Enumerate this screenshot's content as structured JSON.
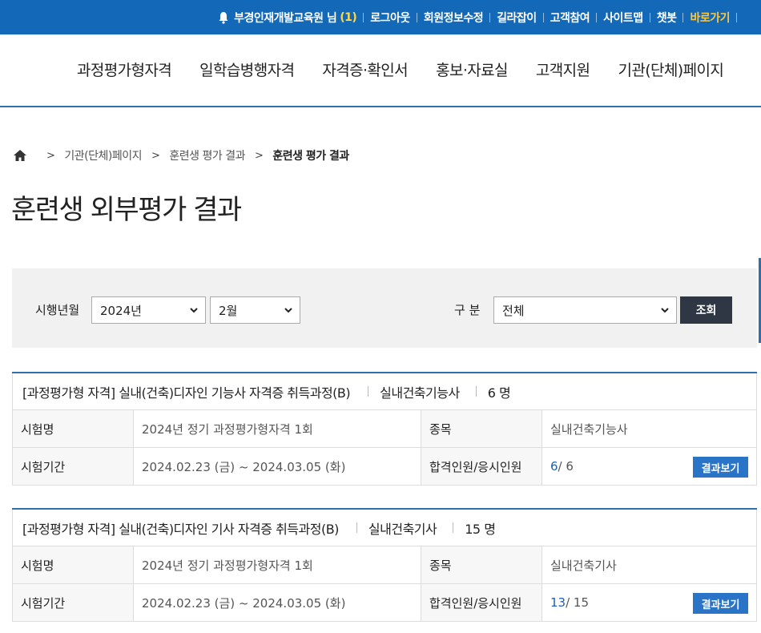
{
  "utility_bar": {
    "user": "부경인재개발교육원 님",
    "notice_count": "(1)",
    "links": [
      "로그아웃",
      "회원정보수정",
      "길라잡이",
      "고객참여",
      "사이트맵",
      "챗봇"
    ],
    "shortcut": "바로가기"
  },
  "nav": {
    "items": [
      "과정평가형자격",
      "일학습병행자격",
      "자격증·확인서",
      "홍보·자료실",
      "고객지원",
      "기관(단체)페이지"
    ]
  },
  "breadcrumb": {
    "items": [
      "기관(단체)페이지",
      "훈련생 평가 결과"
    ],
    "current": "훈련생 평가 결과"
  },
  "page_title": "훈련생 외부평가 결과",
  "search": {
    "date_label": "시행년월",
    "year": "2024년",
    "month": "2월",
    "category_label": "구 분",
    "category": "전체",
    "submit": "조회"
  },
  "results": [
    {
      "course": "[과정평가형 자격] 실내(건축)디자인 기능사 자격증 취득과정(B)",
      "item": "실내건축기능사",
      "count": "6 명",
      "exam_name_label": "시험명",
      "exam_name": "2024년 정기 과정평가형자격 1회",
      "subject_label": "종목",
      "subject": "실내건축기능사",
      "period_label": "시험기간",
      "period": "2024.02.23 (금) ~ 2024.03.05 (화)",
      "pass_label": "합격인원/응시인원",
      "passed": "6",
      "applicants": "/ 6",
      "button": "결과보기"
    },
    {
      "course": "[과정평가형 자격] 실내(건축)디자인 기사 자격증 취득과정(B)",
      "item": "실내건축기사",
      "count": "15 명",
      "exam_name_label": "시험명",
      "exam_name": "2024년 정기 과정평가형자격 1회",
      "subject_label": "종목",
      "subject": "실내건축기사",
      "period_label": "시험기간",
      "period": "2024.02.23 (금) ~ 2024.03.05 (화)",
      "pass_label": "합격인원/응시인원",
      "passed": "13",
      "applicants": "/ 15",
      "button": "결과보기"
    }
  ],
  "colors": {
    "topbar": "#1468b8",
    "accent_line": "#2f6fae",
    "shortcut": "#ffc83c",
    "search_button": "#2e3743",
    "result_button": "#2a74c7",
    "pass_count": "#1d5fb0"
  },
  "icons": [
    "bell-icon",
    "home-icon",
    "chevron-right-icon",
    "chevron-down-icon"
  ]
}
